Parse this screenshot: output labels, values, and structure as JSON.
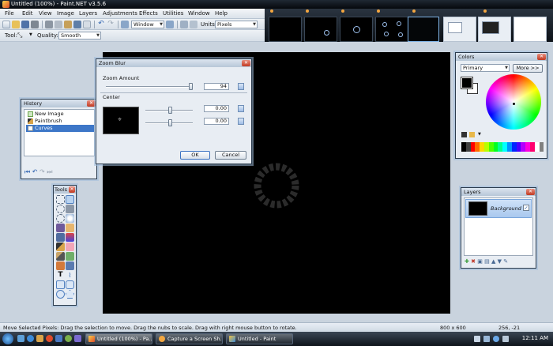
{
  "window": {
    "title": "Untitled (100%) - Paint.NET v3.5.6"
  },
  "menu": [
    "File",
    "Edit",
    "View",
    "Image",
    "Layers",
    "Adjustments",
    "Effects",
    "Utilities",
    "Window",
    "Help"
  ],
  "toolbar": {
    "window_dropdown": "Window",
    "units_label": "Units:",
    "units_value": "Pixels",
    "tool_label": "Tool:",
    "quality_label": "Quality:",
    "quality_value": "Smooth"
  },
  "history": {
    "title": "History",
    "items": [
      "New Image",
      "Paintbrush",
      "Curves"
    ]
  },
  "tools": {
    "title": "Tools"
  },
  "colors": {
    "title": "Colors",
    "primary_dropdown": "Primary",
    "more_button": "More >>",
    "palette": [
      "#000000",
      "#404040",
      "#ff0000",
      "#ff6a00",
      "#ffd800",
      "#b6ff00",
      "#4cff00",
      "#00ff21",
      "#00ff90",
      "#00ffff",
      "#0094ff",
      "#0026ff",
      "#4800ff",
      "#b200ff",
      "#ff00dc",
      "#ff006e",
      "#ffffff",
      "#808080"
    ]
  },
  "layers": {
    "title": "Layers",
    "items": [
      {
        "name": "Background",
        "visible": true
      }
    ]
  },
  "zoom_blur": {
    "title": "Zoom Blur",
    "zoom_amount_label": "Zoom Amount",
    "zoom_amount": "94",
    "center_label": "Center",
    "center_x": "0.00",
    "center_y": "0.00",
    "ok_label": "OK",
    "cancel_label": "Cancel"
  },
  "status": {
    "message": "Move Selected Pixels: Drag the selection to move. Drag the nubs to scale. Drag with right mouse button to rotate.",
    "size": "800 x 600",
    "cursor": "256, -21"
  },
  "taskbar": {
    "tasks": [
      "Untitled (100%) - Pa...",
      "Capture a Screen Sh...",
      "Untitled - Paint"
    ],
    "clock": "12:11 AM"
  }
}
